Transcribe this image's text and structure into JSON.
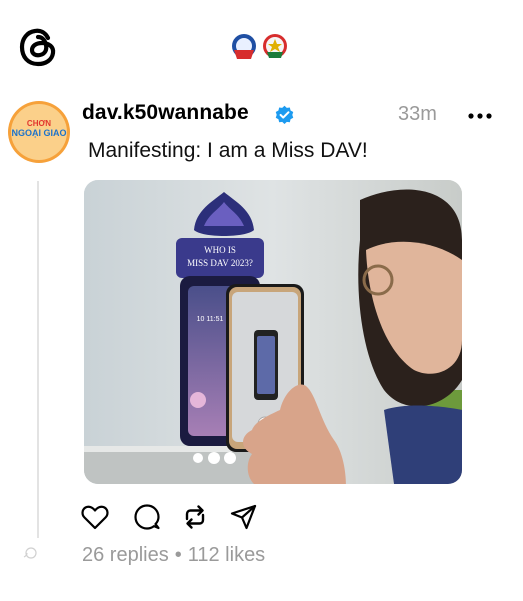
{
  "header": {
    "logo_icon": "threads-logo-icon",
    "badges_icon": "organization-badges-icon"
  },
  "post": {
    "avatar_lines": [
      "CHƠN",
      "NGOẠI GIAO",
      ""
    ],
    "username": "dav.k50wannabe",
    "verified_icon": "verified-badge-icon",
    "timestamp": "33m",
    "more_icon": "more-options-icon",
    "text": "Manifesting: I am a Miss DAV!",
    "image_sign_lines": [
      "WHO IS",
      "MISS DAV 2023?"
    ],
    "phone_clock": "10 11:51"
  },
  "actions": {
    "like_icon": "heart-icon",
    "comment_icon": "comment-icon",
    "repost_icon": "repost-icon",
    "share_icon": "send-icon"
  },
  "stats": {
    "replies": "26 replies",
    "separator": "•",
    "likes": "112 likes"
  },
  "colors": {
    "verified": "#1d9bf0",
    "secondary_text": "#9a9a9a",
    "thread_line": "#e3e3e3"
  }
}
